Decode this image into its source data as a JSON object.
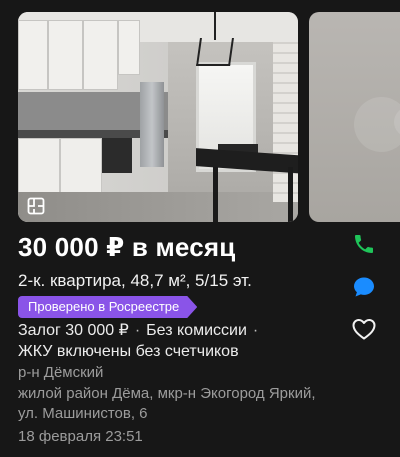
{
  "listing": {
    "price": "30 000 ₽ в месяц",
    "title": "2-к. квартира, 48,7 м², 5/15 эт.",
    "badge": "Проверено в Росреестре",
    "terms": {
      "deposit": "Залог 30 000 ₽",
      "commission": "Без комиссии",
      "utilities": "ЖКУ включены без счетчиков"
    },
    "district": "р-н Дёмский",
    "address": "жилой район Дёма, мкр-н Экогород Яркий, ул. Машинистов, 6",
    "date": "18 февраля 23:51"
  },
  "icons": {
    "gallery": "floorplan-icon",
    "phone": "phone-icon",
    "chat": "chat-icon",
    "favorite": "heart-icon"
  },
  "colors": {
    "background": "#171717",
    "badge": "#8a54e8",
    "phone": "#1fc55a",
    "chat": "#1a8cff",
    "secondary_text": "#9c9c9c"
  }
}
